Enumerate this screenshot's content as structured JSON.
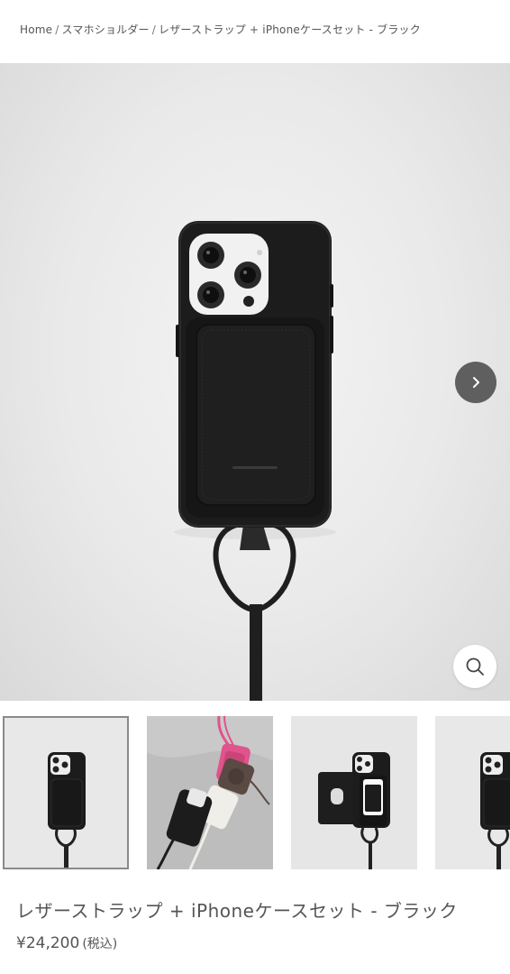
{
  "breadcrumb": {
    "home": "Home",
    "separator": "/",
    "category": "スマホショルダー",
    "current": "レザーストラップ + iPhoneケースセット - ブラック"
  },
  "gallery": {
    "next_icon": "chevron-right-icon",
    "zoom_icon": "search-icon",
    "thumbnails": [
      {
        "name": "black-case-with-strap"
      },
      {
        "name": "colorful-cases-flatlay"
      },
      {
        "name": "card-pocket-open"
      },
      {
        "name": "black-case-with-strap-partial"
      }
    ]
  },
  "product": {
    "title": "レザーストラップ + iPhoneケースセット - ブラック",
    "price": "¥24,200",
    "tax_label": "(税込)"
  },
  "colors": {
    "leather": "#1c1c1c",
    "accent_pink": "#e0538c",
    "button_gray": "#5f5f5f"
  }
}
